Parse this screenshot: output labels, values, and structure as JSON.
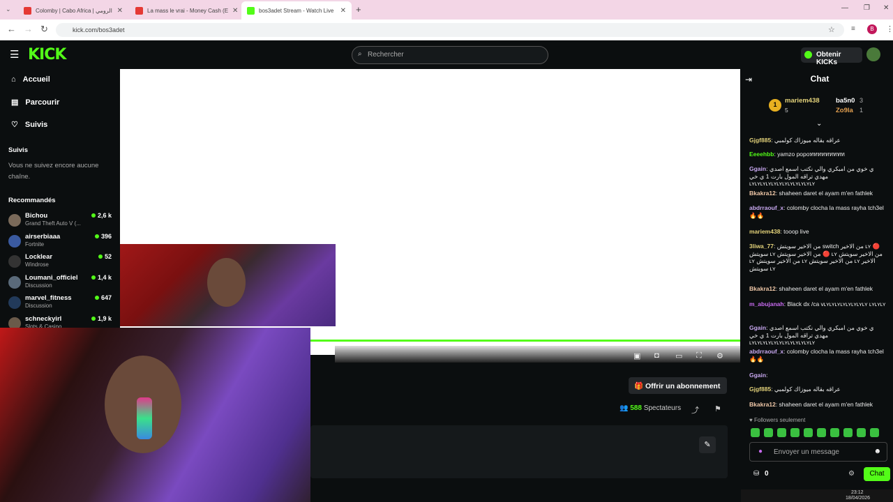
{
  "browser": {
    "tabs": [
      {
        "label": "Colomby | Cabo Africa | الرومي",
        "color": "#e53935"
      },
      {
        "label": "La mass le vrai - Money Cash (E",
        "color": "#e53935"
      },
      {
        "label": "bos3adet Stream - Watch Live",
        "color": "#53fc18"
      }
    ],
    "url": "kick.com/bos3adet",
    "profile_initial": "B"
  },
  "header": {
    "logo": "KICK",
    "search_placeholder": "Rechercher",
    "kicks_button": "Obtenir KICKs"
  },
  "sidebar": {
    "nav": [
      {
        "label": "Accueil",
        "icon": "home-icon",
        "glyph": "⌂"
      },
      {
        "label": "Parcourir",
        "icon": "browse-icon",
        "glyph": "▤"
      },
      {
        "label": "Suivis",
        "icon": "heart-icon",
        "glyph": "♡"
      }
    ],
    "suivis_title": "Suivis",
    "suivis_empty": "Vous ne suivez encore aucune chaîne.",
    "recommended_title": "Recommandés",
    "recommended": [
      {
        "name": "Bichou",
        "category": "Grand Theft Auto V (...",
        "viewers": "2,6 k",
        "color": "#7a6a5a"
      },
      {
        "name": "airserbiaaa",
        "category": "Fortnite",
        "viewers": "396",
        "color": "#3a5aa0"
      },
      {
        "name": "Locklear",
        "category": "Windrose",
        "viewers": "52",
        "color": "#333"
      },
      {
        "name": "Loumani_officiel",
        "category": "Discussion",
        "viewers": "1,4 k",
        "color": "#5a6a7a"
      },
      {
        "name": "marvel_fitness",
        "category": "Discussion",
        "viewers": "647",
        "color": "#223a5a"
      },
      {
        "name": "schneckyirl",
        "category": "Slots & Casino",
        "viewers": "1,9 k",
        "color": "#6a5a4a"
      }
    ]
  },
  "stream": {
    "subscribe_button": "Offrir un abonnement",
    "viewers_count": "588",
    "viewers_label": "Spectateurs"
  },
  "chat": {
    "title": "Chat",
    "leaderboard": [
      {
        "name": "mariem438",
        "count": "5",
        "rank": "1"
      },
      {
        "name": "ba5n0",
        "count": "3"
      },
      {
        "name": "Zo9la",
        "count": "1"
      }
    ],
    "messages": [
      {
        "user": "Gjgf885",
        "color": "#e3d27a",
        "text": "عراقه بقاله ميوزاك كولمبي"
      },
      {
        "user": "Eeeehbb",
        "color": "#53fc18",
        "text": "yamzo popoททททททททท"
      },
      {
        "user": "Ggain",
        "color": "#c8a8f0",
        "text": "ي خوي من امبكري والي نكتب اسمع اصدي مهدي تراقه المول بارت 1 ي خي ʟʏʟʏʟʏʟʏʟʏʟʏʟʏʟʏʟʏʟʏʟʏʟʏ"
      },
      {
        "user": "Bkakra12",
        "color": "#f0c8a8",
        "text": "shaheen daret el ayam m'en fathlek"
      },
      {
        "user": "abdrraouf_x",
        "color": "#c8a8f0",
        "text": "colomby clocha la mass rayha tch3el 🔥🔥"
      },
      {
        "user": "mariem438",
        "color": "#e3d27a",
        "text": "tooop live"
      },
      {
        "user": "3liwa_77",
        "color": "#e3d27a",
        "text": "من الاخير سويتش switch من الاخير ʟʏ 🔴 سويتش ʟʏ من الاخير سويتش 🔴 ʟʏ من الاخير سويتش ʟʏ من الاخير سويتش ʟʏ من الاخير سويتش ʟʏ الاخير سويتش ʟʏ"
      },
      {
        "user": "Bkakra12",
        "color": "#f0c8a8",
        "text": "shaheen daret el ayam m'en fathlek"
      },
      {
        "user": "m_abujanah",
        "color": "#c86af0",
        "text": "Black dx /ca vʟʏʟʏʟʏʟʏʟʏʟʏʟʏʟʏ ʟʏʟʏʟʏ"
      },
      {
        "user": "Ggain",
        "color": "#c8a8f0",
        "text": "ي خوي من امبكري والي نكتب اسمع اصدي مهدي تراقه المول بارت 1 ي خي ʟʏʟʏʟʏʟʏʟʏʟʏʟʏʟʏʟʏʟʏʟʏʟʏ"
      },
      {
        "user": "abdrraouf_x",
        "color": "#c8a8f0",
        "text": "colomby clocha la mass rayha tch3el 🔥🔥"
      },
      {
        "user": "Ggain",
        "color": "#c8a8f0",
        "text": ""
      },
      {
        "user": "Gjgf885",
        "color": "#e3d27a",
        "text": "عراقه بقاله ميوزاك كولمبي"
      },
      {
        "user": "Bkakra12",
        "color": "#f0c8a8",
        "text": "shaheen daret el ayam m'en fathlek"
      }
    ],
    "followers_only": "Followers seulement",
    "input_placeholder": "Envoyer un message",
    "points": "0",
    "chat_button": "Chat"
  },
  "taskbar": {
    "time": "23:12",
    "date": "18/04/2026"
  }
}
